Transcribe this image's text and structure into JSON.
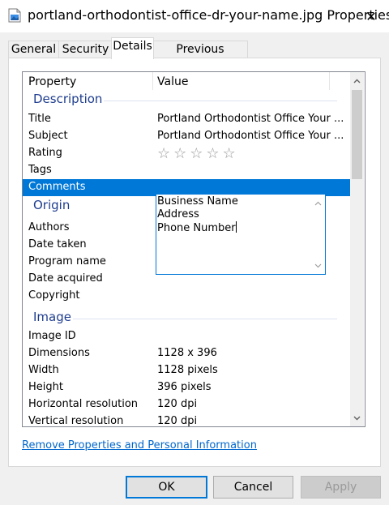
{
  "window": {
    "title": "portland-orthodontist-office-dr-your-name.jpg Properties",
    "close_glyph": "✕"
  },
  "tabs": [
    {
      "label": "General"
    },
    {
      "label": "Security"
    },
    {
      "label": "Details"
    },
    {
      "label": "Previous Versions"
    }
  ],
  "table": {
    "col_property": "Property",
    "col_value": "Value"
  },
  "groups": {
    "description": "Description",
    "origin": "Origin",
    "image": "Image"
  },
  "rows": {
    "title": {
      "k": "Title",
      "v": "Portland Orthodontist Office Your ..."
    },
    "subject": {
      "k": "Subject",
      "v": "Portland Orthodontist Office Your ..."
    },
    "rating": {
      "k": "Rating",
      "stars": "★★★★★",
      "value": 0,
      "max": 5
    },
    "tags": {
      "k": "Tags",
      "v": ""
    },
    "comments": {
      "k": "Comments",
      "lines": [
        "Business Name",
        "Address",
        "Phone Number"
      ]
    },
    "authors": {
      "k": "Authors",
      "v": ""
    },
    "date_taken": {
      "k": "Date taken",
      "v": ""
    },
    "program_name": {
      "k": "Program name",
      "v": ""
    },
    "date_acquired": {
      "k": "Date acquired",
      "v": ""
    },
    "copyright": {
      "k": "Copyright",
      "v": ""
    },
    "image_id": {
      "k": "Image ID",
      "v": ""
    },
    "dimensions": {
      "k": "Dimensions",
      "v": "1128 x 396"
    },
    "width": {
      "k": "Width",
      "v": "1128 pixels"
    },
    "height": {
      "k": "Height",
      "v": "396 pixels"
    },
    "hres": {
      "k": "Horizontal resolution",
      "v": "120 dpi"
    },
    "vres": {
      "k": "Vertical resolution",
      "v": "120 dpi"
    }
  },
  "link": "Remove Properties and Personal Information",
  "buttons": {
    "ok": "OK",
    "cancel": "Cancel",
    "apply": "Apply"
  },
  "colors": {
    "selection": "#0078d7",
    "group_text": "#1e3d8f",
    "link": "#0066cc"
  },
  "icons": {
    "window": "image-file-icon",
    "close": "close-icon",
    "scroll_up": "chevron-up-icon",
    "scroll_down": "chevron-down-icon"
  }
}
